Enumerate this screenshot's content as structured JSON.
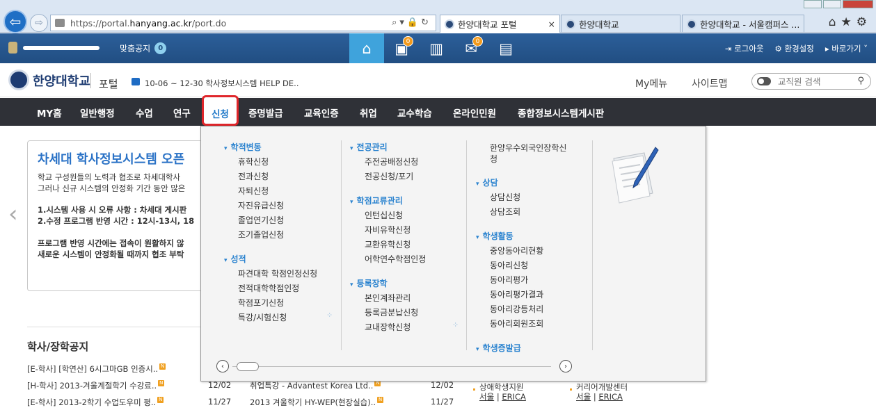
{
  "browser": {
    "url_prefix": "https://portal.",
    "url_host": "hanyang.ac.kr",
    "url_path": "/port.do",
    "addr_tools": "⌕▾🔒↻",
    "tabs": [
      {
        "label": "한양대학교 포털",
        "close": "×"
      },
      {
        "label": "한양대학교"
      },
      {
        "label": "한양대학교 - 서울캠퍼스 ..."
      }
    ],
    "icons": [
      "back-icon",
      "forward-icon",
      "home-icon",
      "star-icon",
      "gear-icon"
    ]
  },
  "topbar": {
    "notice_label": "맞춤공지",
    "notice_count": "0",
    "quick_badges": [
      "0",
      "0"
    ],
    "logout": "로그아웃",
    "settings": "환경설정",
    "shortcut": "바로가기"
  },
  "header": {
    "logo": "한양대학교",
    "portal": "포털",
    "announcement": "10-06 ~ 12-30 학사정보시스템 HELP DE..",
    "mymenu": "My메뉴",
    "sitemap": "사이트맵",
    "search_placeholder": "교직원 검색"
  },
  "nav": {
    "items": [
      "MY홈",
      "일반행정",
      "수업",
      "연구",
      "신청",
      "증명발급",
      "교육인증",
      "취업",
      "교수학습",
      "온라인민원",
      "종합정보시스템게시판"
    ],
    "active": "신청"
  },
  "banner": {
    "title": "차세대 학사정보시스템 오픈",
    "lines": [
      "학교 구성원들의 노력과 협조로 차세대학사",
      "그러나 신규 시스템의 안정화 기간 동안 많은",
      "1.시스템 사용 시 오류 사항 : 차세대 게시판",
      "2.수정 프로그램 반영 시간 : 12시-13시, 18",
      "프로그램 반영 시간에는 접속이 원활하지 않",
      "새로운 시스템이 안정화될 때까지 협조 부탁"
    ]
  },
  "notices": {
    "title": "학사/장학공지",
    "rows": [
      {
        "text": "[E-학사] [학연산] 6시그마GB 인증시.."
      },
      {
        "text": "[H-학사] 2013-겨울계절학기 수강료..",
        "date": "12/02",
        "text2": "취업특강 - Advantest Korea Ltd..",
        "date2": "12/02",
        "c3": "상애학생지원",
        "c4": "커리어개발센터"
      },
      {
        "text": "[E-학사] 2013-2학기 수업도우미 평..",
        "date": "11/27",
        "text2": "2013 겨울학기 HY-WEP(현장실습)..",
        "date2": "11/27",
        "c3a": "서울",
        "c3b": "ERICA",
        "c4a": "서울",
        "c4b": "ERICA"
      }
    ],
    "new_mark": "N",
    "sep": "|"
  },
  "mega": {
    "col1": [
      {
        "head": "학적변동",
        "items": [
          "휴학신청",
          "전과신청",
          "자퇴신청",
          "자진유급신청",
          "졸업연기신청",
          "조기졸업신청"
        ]
      },
      {
        "head": "성적",
        "items": [
          "파견대학 학점인정신청",
          "전적대학학점인정",
          "학점포기신청",
          "특강/시험신청"
        ]
      }
    ],
    "col2": [
      {
        "head": "전공관리",
        "items": [
          "주전공배정신청",
          "전공신청/포기"
        ]
      },
      {
        "head": "학점교류관리",
        "items": [
          "인턴십신청",
          "자비유학신청",
          "교환유학신청",
          "어학연수학점인정"
        ]
      },
      {
        "head": "등록장학",
        "items": [
          "본인계좌관리",
          "등록금분납신청",
          "교내장학신청"
        ]
      }
    ],
    "col3_top": [
      "한양우수외국인장학신",
      "청"
    ],
    "col3": [
      {
        "head": "상담",
        "items": [
          "상담신청",
          "상담조회"
        ]
      },
      {
        "head": "학생활동",
        "items": [
          "중앙동아리현황",
          "동아리신청",
          "동아리평가",
          "동아리평가결과",
          "동아리강등처리",
          "동아리회원조회"
        ]
      },
      {
        "head": "학생증발급",
        "items": []
      }
    ],
    "more_glyph": "⁘",
    "scroll_prev": "‹",
    "scroll_next": "›"
  }
}
